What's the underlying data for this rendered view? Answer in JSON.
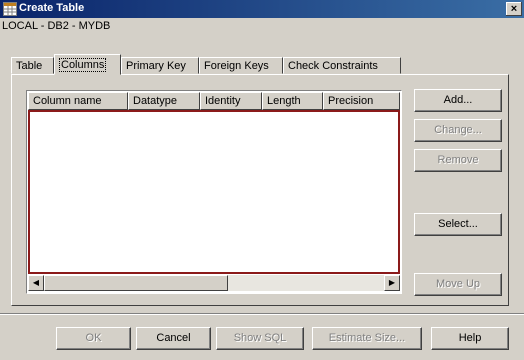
{
  "window": {
    "title": "Create Table",
    "close_symbol": "×"
  },
  "connection_path": "LOCAL - DB2 - MYDB",
  "tabs": [
    {
      "label": "Table"
    },
    {
      "label": "Columns",
      "active": true
    },
    {
      "label": "Primary Key"
    },
    {
      "label": "Foreign Keys"
    },
    {
      "label": "Check Constraints"
    }
  ],
  "table": {
    "columns": [
      "Column name",
      "Datatype",
      "Identity",
      "Length",
      "Precision"
    ],
    "rows": []
  },
  "side_buttons": {
    "add": {
      "label": "Add...",
      "enabled": true
    },
    "change": {
      "label": "Change...",
      "enabled": false
    },
    "remove": {
      "label": "Remove",
      "enabled": false
    },
    "select": {
      "label": "Select...",
      "enabled": true
    },
    "move_up": {
      "label": "Move Up",
      "enabled": false
    }
  },
  "bottom_buttons": {
    "ok": {
      "label": "OK",
      "enabled": false
    },
    "cancel": {
      "label": "Cancel",
      "enabled": true
    },
    "show_sql": {
      "label": "Show SQL",
      "enabled": false
    },
    "estimate_size": {
      "label": "Estimate Size...",
      "enabled": false
    },
    "help": {
      "label": "Help",
      "enabled": true
    }
  },
  "icons": {
    "title_icon": "table-icon",
    "scroll_left": "◀",
    "scroll_right": "▶"
  }
}
